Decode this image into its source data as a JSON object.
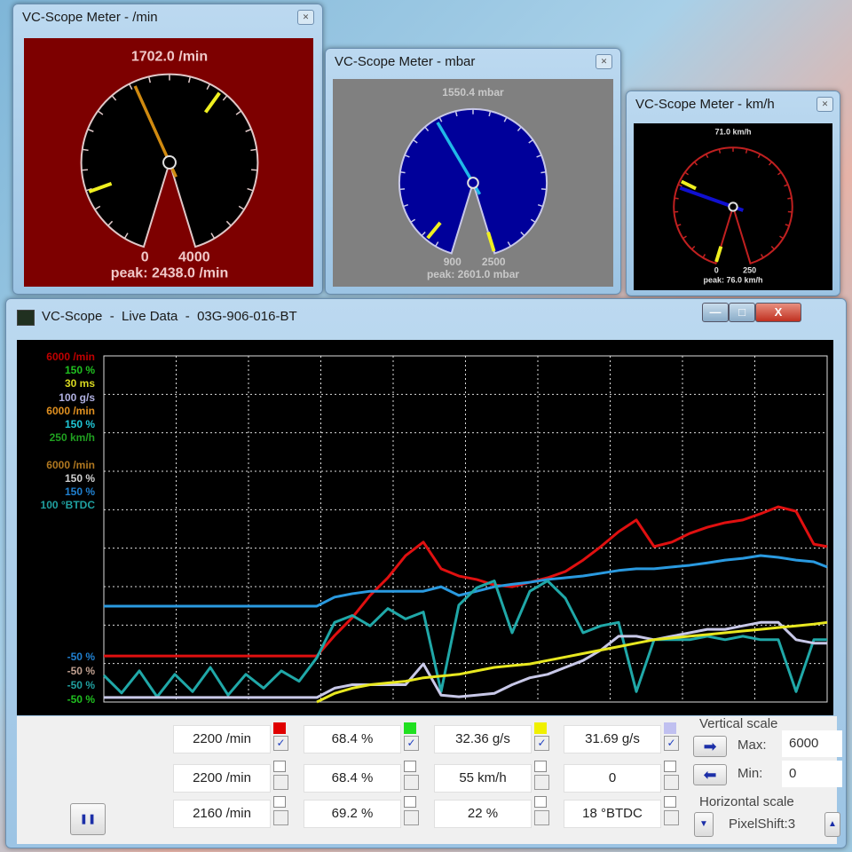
{
  "meters": [
    {
      "title": "VC-Scope Meter - /min",
      "reading": "1702.0 /min",
      "min_label": "0",
      "max_label": "4000",
      "peak": "peak: 2438.0 /min",
      "scale": [
        0,
        4000
      ],
      "value": 1702,
      "peak_value": 2438,
      "low_marker": 650,
      "colors": {
        "bg": "#7d0000",
        "face": "#000000",
        "rim": "#e0c8c8",
        "needle": "#d08a10",
        "text": "#f0c8c8"
      }
    },
    {
      "title": "VC-Scope Meter - mbar",
      "reading": "1550.4 mbar",
      "min_label": "900",
      "max_label": "2500",
      "peak": "peak: 2601.0 mbar",
      "scale": [
        900,
        2500
      ],
      "value": 1550.4,
      "peak_value": 2601,
      "low_marker": 1010,
      "colors": {
        "bg": "#808080",
        "face": "#00009a",
        "rim": "#c8c8e8",
        "needle": "#20b8e8",
        "text": "#c8c8c8"
      }
    },
    {
      "title": "VC-Scope Meter - km/h",
      "reading": "71.0 km/h",
      "min_label": "0",
      "max_label": "250",
      "peak": "peak: 76.0 km/h",
      "scale": [
        0,
        250
      ],
      "value": 71,
      "peak_value": 76,
      "low_marker": 0,
      "colors": {
        "bg": "#000000",
        "face": "#000000",
        "rim": "#c02020",
        "needle": "#1010d0",
        "text": "#e0e0e0"
      }
    }
  ],
  "main": {
    "title": "VC-Scope  -  Live Data  -  03G-906-016-BT",
    "controls": {
      "minimize": "—",
      "maximize": "□",
      "close": "X"
    },
    "legend_top": [
      {
        "text": "6000 /min",
        "color": "#c00000"
      },
      {
        "text": "150 %",
        "color": "#20c020"
      },
      {
        "text": "30 ms",
        "color": "#d8d820"
      },
      {
        "text": "100 g/s",
        "color": "#b0b0e0"
      },
      {
        "text": "6000 /min",
        "color": "#e09020"
      },
      {
        "text": "150 %",
        "color": "#20c8d8"
      },
      {
        "text": "250 km/h",
        "color": "#20a020"
      },
      {
        "text": "",
        "color": "#101080"
      },
      {
        "text": "6000 /min",
        "color": "#b07820"
      },
      {
        "text": "150 %",
        "color": "#d0d0d0"
      },
      {
        "text": "150 %",
        "color": "#2080d0"
      },
      {
        "text": "100 °BTDC",
        "color": "#20a0a0"
      }
    ],
    "legend_bottom": [
      {
        "text": "-50 %",
        "color": "#2080d0"
      },
      {
        "text": "-50 %",
        "color": "#c0a090"
      },
      {
        "text": "-50 %",
        "color": "#20a0a0"
      },
      {
        "text": "-50 %",
        "color": "#20c020"
      }
    ],
    "traces": [
      {
        "color": "#e01010",
        "values": [
          13.3,
          13.3,
          13.3,
          13.3,
          13.3,
          13.3,
          13.3,
          13.3,
          13.3,
          13.3,
          13.3,
          13.3,
          13.3,
          19.2,
          24.4,
          30.8,
          35.9,
          42.3,
          46.2,
          38.5,
          36.4,
          35.4,
          33.8,
          33.3,
          34.6,
          35.9,
          37.7,
          41,
          44.9,
          49.2,
          52.6,
          44.9,
          46.2,
          48.7,
          50.5,
          51.8,
          52.6,
          54.4,
          56.4,
          55.1,
          45.6,
          44.9
        ]
      },
      {
        "color": "#2a9ae0",
        "values": [
          27.7,
          27.7,
          27.7,
          27.7,
          27.7,
          27.7,
          27.7,
          27.7,
          27.7,
          27.7,
          27.7,
          27.7,
          27.7,
          30.3,
          31.3,
          32,
          32,
          32,
          32,
          33.3,
          30.8,
          32,
          33.3,
          34,
          34.6,
          35.4,
          35.9,
          36.4,
          37.2,
          38,
          38.5,
          38.5,
          39,
          39.5,
          40.2,
          41,
          41.5,
          42.3,
          41.8,
          41,
          40.5,
          39
        ]
      },
      {
        "color": "#20a8a8",
        "values": [
          7.7,
          2.6,
          9,
          1.5,
          8,
          3,
          10,
          2,
          8,
          4,
          9,
          6,
          12.8,
          23,
          25,
          22,
          27,
          24,
          26,
          3,
          28,
          33,
          35,
          20,
          32,
          35,
          30,
          20,
          22,
          23,
          3,
          18,
          18,
          18,
          19,
          18,
          19,
          18,
          18,
          3,
          18,
          18
        ]
      },
      {
        "color": "#c8c8e8",
        "values": [
          1.3,
          1.3,
          1.3,
          1.3,
          1.3,
          1.3,
          1.3,
          1.3,
          1.3,
          1.3,
          1.3,
          1.3,
          1.3,
          4,
          5,
          5,
          5,
          5,
          11,
          2,
          1.5,
          2,
          2.5,
          5,
          7,
          8,
          10,
          12,
          15,
          19,
          19,
          18,
          19,
          20,
          21,
          21,
          22,
          23,
          23,
          18,
          17,
          17
        ]
      },
      {
        "color": "#e8e820",
        "values": [
          null,
          null,
          null,
          null,
          null,
          null,
          null,
          null,
          null,
          null,
          null,
          null,
          0,
          2.5,
          4,
          5,
          5.5,
          6,
          7,
          7.5,
          8,
          9,
          10,
          10.5,
          11,
          12,
          13,
          14,
          15,
          16,
          17,
          18,
          18.5,
          19,
          19.5,
          20,
          20.5,
          21,
          21.5,
          22,
          22.5,
          23
        ]
      }
    ],
    "rows": [
      [
        {
          "value": "2200 /min",
          "color": "#e00000",
          "checked": true
        },
        {
          "value": "68.4 %",
          "color": "#20e020",
          "checked": true
        },
        {
          "value": "32.36 g/s",
          "color": "#f0f000",
          "checked": true
        },
        {
          "value": "31.69 g/s",
          "color": "#c0c0f0",
          "checked": true
        }
      ],
      [
        {
          "value": "2200 /min",
          "checked": false
        },
        {
          "value": "68.4 %",
          "checked": false
        },
        {
          "value": "55 km/h",
          "checked": false
        },
        {
          "value": "0",
          "checked": false
        }
      ],
      [
        {
          "value": "2160 /min",
          "checked": false
        },
        {
          "value": "69.2 %",
          "checked": false
        },
        {
          "value": "22 %",
          "checked": false
        },
        {
          "value": "18 °BTDC",
          "checked": false
        }
      ]
    ],
    "check_mark": "✓",
    "pause_icon": "❚❚",
    "vertical_scale": {
      "label": "Vertical scale",
      "max_label": "Max:",
      "max_value": "6000",
      "min_label": "Min:",
      "min_value": "0",
      "right_arrow": "➡",
      "left_arrow": "⬅"
    },
    "horizontal_scale": {
      "label": "Horizontal scale",
      "value": "PixelShift:3",
      "down": "▼",
      "up": "▲"
    }
  }
}
